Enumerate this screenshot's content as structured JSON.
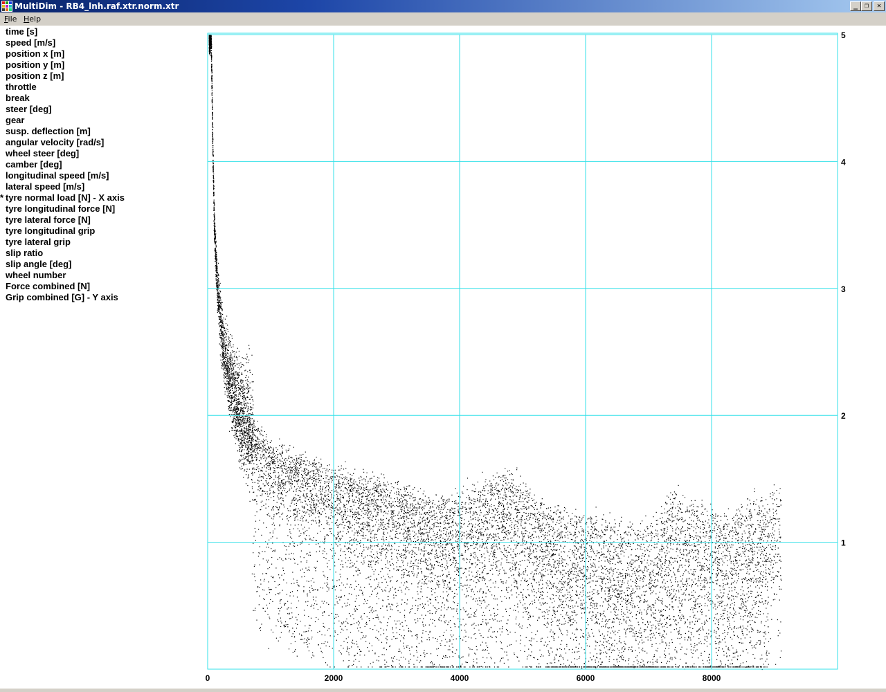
{
  "window": {
    "title": "MultiDim - RB4_lnh.raf.xtr.norm.xtr",
    "minimize_label": "_",
    "restore_label": "❐",
    "close_label": "✕"
  },
  "menu": {
    "file_hotkey": "F",
    "file_rest": "ile",
    "help_hotkey": "H",
    "help_rest": "elp"
  },
  "variables": [
    {
      "mark": "",
      "label": "time [s]"
    },
    {
      "mark": "",
      "label": "speed [m/s]"
    },
    {
      "mark": "",
      "label": "position x [m]"
    },
    {
      "mark": "",
      "label": "position y [m]"
    },
    {
      "mark": "",
      "label": "position z [m]"
    },
    {
      "mark": "",
      "label": "throttle"
    },
    {
      "mark": "",
      "label": "break"
    },
    {
      "mark": "",
      "label": "steer [deg]"
    },
    {
      "mark": "",
      "label": "gear"
    },
    {
      "mark": "",
      "label": "susp. deflection [m]"
    },
    {
      "mark": "",
      "label": "angular velocity [rad/s]"
    },
    {
      "mark": "",
      "label": "wheel steer [deg]"
    },
    {
      "mark": "",
      "label": "camber [deg]"
    },
    {
      "mark": "",
      "label": "longitudinal speed [m/s]"
    },
    {
      "mark": "",
      "label": "lateral speed [m/s]"
    },
    {
      "mark": "*",
      "label": "tyre normal load [N] - X axis"
    },
    {
      "mark": "",
      "label": "tyre longitudinal force [N]"
    },
    {
      "mark": "",
      "label": "tyre lateral force [N]"
    },
    {
      "mark": "",
      "label": "tyre longitudinal grip"
    },
    {
      "mark": "",
      "label": "tyre lateral grip"
    },
    {
      "mark": "",
      "label": "slip ratio"
    },
    {
      "mark": "",
      "label": "slip angle [deg]"
    },
    {
      "mark": "",
      "label": "wheel number"
    },
    {
      "mark": "",
      "label": "Force combined [N]"
    },
    {
      "mark": "",
      "label": "Grip combined [G] - Y axis"
    }
  ],
  "chart_data": {
    "type": "scatter",
    "title": "",
    "xlabel": "",
    "ylabel": "",
    "xlim": [
      0,
      10000
    ],
    "ylim": [
      0,
      5
    ],
    "x_ticks": [
      0,
      2000,
      4000,
      6000,
      8000
    ],
    "x_tick_labels": [
      "0",
      "2000",
      "4000",
      "6000",
      "8000"
    ],
    "y_ticks": [
      1,
      2,
      3,
      4,
      5
    ],
    "y_tick_labels": [
      "1",
      "2",
      "3",
      "4",
      "5"
    ],
    "y_axis_side": "right",
    "grid": true,
    "grid_color": "#33e0e8",
    "point_color": "#000000",
    "legend": "none",
    "point_density_ridge": [
      {
        "x": 50,
        "y": 5.0
      },
      {
        "x": 80,
        "y": 4.0
      },
      {
        "x": 100,
        "y": 3.5
      },
      {
        "x": 150,
        "y": 3.0
      },
      {
        "x": 250,
        "y": 2.5
      },
      {
        "x": 500,
        "y": 2.05
      },
      {
        "x": 1000,
        "y": 1.75
      },
      {
        "x": 2000,
        "y": 1.55
      },
      {
        "x": 3000,
        "y": 1.45
      },
      {
        "x": 3600,
        "y": 1.3
      },
      {
        "x": 4800,
        "y": 1.55
      },
      {
        "x": 5400,
        "y": 1.25
      },
      {
        "x": 6000,
        "y": 1.2
      },
      {
        "x": 7000,
        "y": 1.1
      },
      {
        "x": 7400,
        "y": 1.4
      },
      {
        "x": 8200,
        "y": 1.2
      },
      {
        "x": 9000,
        "y": 1.4
      }
    ]
  }
}
